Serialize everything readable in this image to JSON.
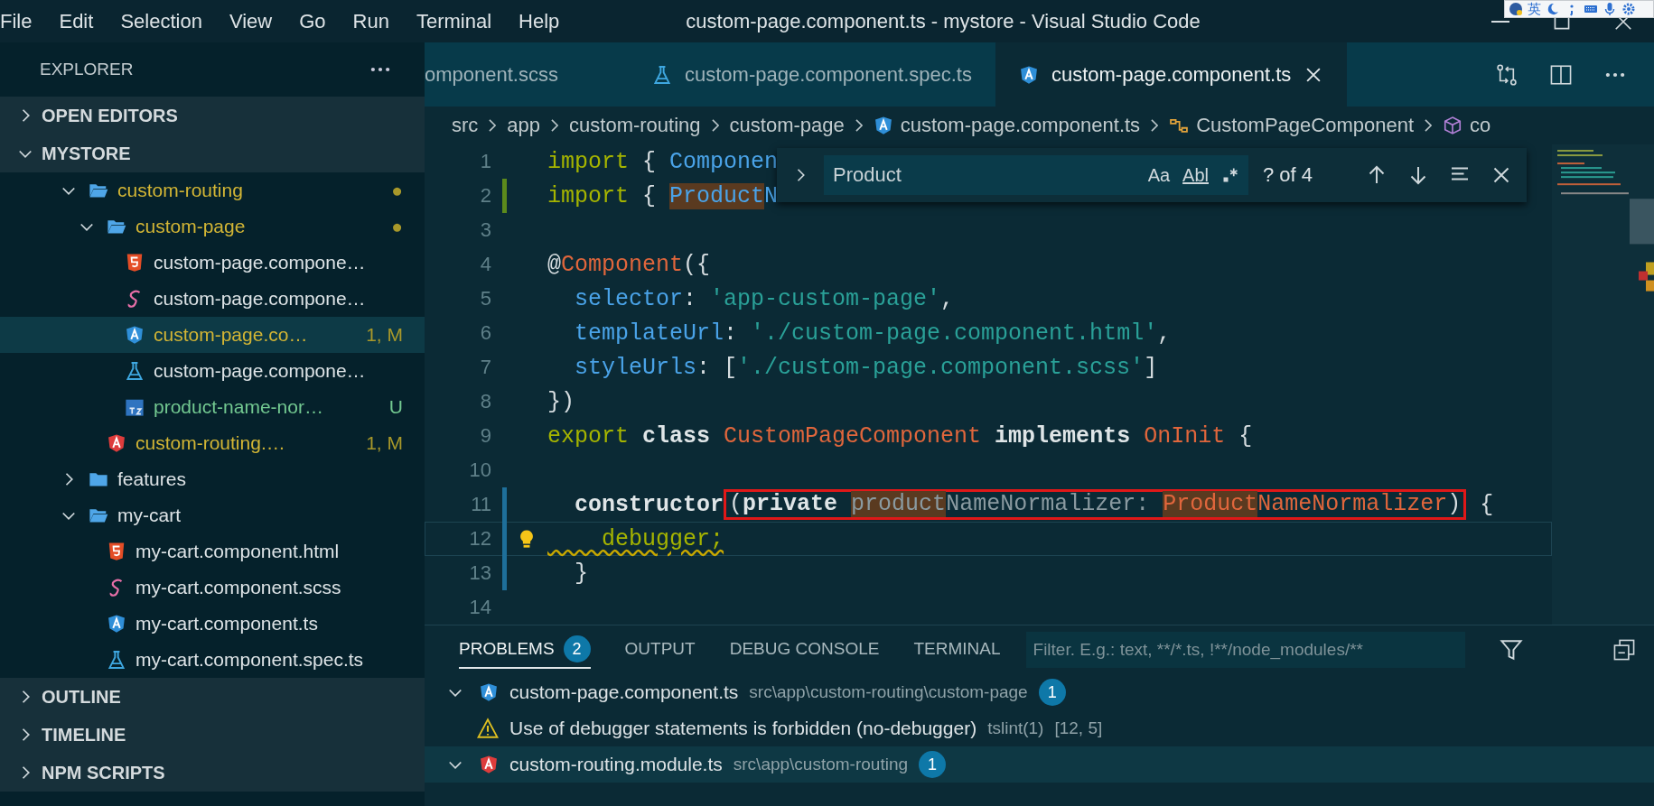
{
  "menu": [
    "File",
    "Edit",
    "Selection",
    "View",
    "Go",
    "Run",
    "Terminal",
    "Help"
  ],
  "window": {
    "title": "custom-page.component.ts - mystore - Visual Studio Code"
  },
  "ime_toolbar": {
    "label": "英"
  },
  "sidebar": {
    "title": "EXPLORER",
    "sections": [
      {
        "label": "OPEN EDITORS",
        "expanded": false
      },
      {
        "label": "MYSTORE",
        "expanded": true
      }
    ],
    "tree": [
      {
        "name": "custom-routing",
        "kind": "folder",
        "modified": true,
        "untracked": false,
        "expanded": true,
        "selected": false,
        "badge": "●",
        "children": [
          {
            "name": "custom-page",
            "kind": "folder",
            "modified": true,
            "untracked": false,
            "expanded": true,
            "selected": false,
            "badge": "●",
            "children": [
              {
                "name": "custom-page.compone…",
                "kind": "html",
                "modified": false,
                "untracked": false,
                "selected": false
              },
              {
                "name": "custom-page.compone…",
                "kind": "scss",
                "modified": false,
                "untracked": false,
                "selected": false
              },
              {
                "name": "custom-page.co…",
                "kind": "angular",
                "modified": true,
                "untracked": false,
                "selected": true,
                "badge": "1, M"
              },
              {
                "name": "custom-page.compone…",
                "kind": "spec",
                "modified": false,
                "untracked": false,
                "selected": false
              },
              {
                "name": "product-name-nor…",
                "kind": "ts",
                "modified": false,
                "untracked": true,
                "selected": false,
                "badge": "U"
              }
            ]
          },
          {
            "name": "custom-routing.…",
            "kind": "module",
            "modified": true,
            "untracked": false,
            "selected": false,
            "badge": "1, M"
          }
        ]
      },
      {
        "name": "features",
        "kind": "folder",
        "modified": false,
        "untracked": false,
        "expanded": false,
        "selected": false
      },
      {
        "name": "my-cart",
        "kind": "folder",
        "modified": false,
        "untracked": false,
        "expanded": true,
        "selected": false,
        "children": [
          {
            "name": "my-cart.component.html",
            "kind": "html",
            "modified": false,
            "untracked": false,
            "selected": false
          },
          {
            "name": "my-cart.component.scss",
            "kind": "scss",
            "modified": false,
            "untracked": false,
            "selected": false
          },
          {
            "name": "my-cart.component.ts",
            "kind": "angular",
            "modified": false,
            "untracked": false,
            "selected": false
          },
          {
            "name": "my-cart.component.spec.ts",
            "kind": "spec",
            "modified": false,
            "untracked": false,
            "selected": false
          }
        ]
      }
    ],
    "bottom_sections": [
      {
        "label": "OUTLINE",
        "expanded": false
      },
      {
        "label": "TIMELINE",
        "expanded": false
      },
      {
        "label": "NPM SCRIPTS",
        "expanded": false
      }
    ]
  },
  "tabs": [
    {
      "label": "omponent.scss",
      "kind": "none",
      "selected": false
    },
    {
      "label": "custom-page.component.spec.ts",
      "kind": "spec",
      "selected": false
    },
    {
      "label": "custom-page.component.ts",
      "kind": "angular",
      "selected": true
    }
  ],
  "breadcrumbs": [
    {
      "label": "src",
      "kind": "none"
    },
    {
      "label": "app",
      "kind": "none"
    },
    {
      "label": "custom-routing",
      "kind": "none"
    },
    {
      "label": "custom-page",
      "kind": "none"
    },
    {
      "label": "custom-page.component.ts",
      "kind": "angular"
    },
    {
      "label": "CustomPageComponent",
      "kind": "class"
    },
    {
      "label": "co",
      "kind": "method"
    }
  ],
  "find": {
    "value": "Product",
    "options": [
      "Aa",
      "Abl"
    ],
    "result": "? of 4"
  },
  "editor": {
    "lines": [
      {
        "number": "1",
        "added": false,
        "modified": false,
        "tokens": [
          {
            "kind": "kw",
            "text": "import"
          },
          {
            "kind": "plain",
            "text": " { "
          },
          {
            "kind": "type",
            "text": "Componen"
          }
        ]
      },
      {
        "number": "2",
        "added": true,
        "modified": false,
        "tokens": [
          {
            "kind": "kw",
            "text": "import"
          },
          {
            "kind": "plain",
            "text": " { "
          },
          {
            "kind": "type",
            "text": "Product",
            "match": true
          },
          {
            "kind": "type",
            "text": "N"
          }
        ]
      },
      {
        "number": "3",
        "added": false,
        "modified": false
      },
      {
        "number": "4",
        "added": false,
        "modified": false,
        "tokens": [
          {
            "kind": "plain",
            "text": "@"
          },
          {
            "kind": "cls",
            "text": "Component"
          },
          {
            "kind": "plain",
            "text": "({"
          }
        ]
      },
      {
        "number": "5",
        "added": false,
        "modified": false,
        "tokens": [
          {
            "kind": "prop",
            "text": "  selector"
          },
          {
            "kind": "plain",
            "text": ": "
          },
          {
            "kind": "str",
            "text": "'app-custom-page'"
          },
          {
            "kind": "plain",
            "text": ","
          }
        ]
      },
      {
        "number": "6",
        "added": false,
        "modified": false,
        "tokens": [
          {
            "kind": "prop",
            "text": "  templateUrl"
          },
          {
            "kind": "plain",
            "text": ": "
          },
          {
            "kind": "str",
            "text": "'./custom-page.component.html'"
          },
          {
            "kind": "plain",
            "text": ","
          }
        ]
      },
      {
        "number": "7",
        "added": false,
        "modified": false,
        "tokens": [
          {
            "kind": "prop",
            "text": "  styleUrls"
          },
          {
            "kind": "plain",
            "text": ": ["
          },
          {
            "kind": "str",
            "text": "'./custom-page.component.scss'"
          },
          {
            "kind": "plain",
            "text": "]"
          }
        ]
      },
      {
        "number": "8",
        "added": false,
        "modified": false,
        "tokens": [
          {
            "kind": "plain",
            "text": "})"
          }
        ]
      },
      {
        "number": "9",
        "added": false,
        "modified": false,
        "tokens": [
          {
            "kind": "kw",
            "text": "export "
          },
          {
            "kind": "bold",
            "text": "class "
          },
          {
            "kind": "cls",
            "text": "CustomPageComponent "
          },
          {
            "kind": "bold",
            "text": "implements "
          },
          {
            "kind": "cls",
            "text": "OnInit"
          },
          {
            "kind": "plain",
            "text": " {"
          }
        ]
      },
      {
        "number": "10",
        "added": false,
        "modified": false
      },
      {
        "number": "11",
        "added": false,
        "modified": true,
        "tokens": [
          {
            "kind": "bold",
            "text": "  constructor"
          },
          {
            "kind": "group",
            "boxed": true,
            "tokens": [
              {
                "kind": "plain",
                "text": "("
              },
              {
                "kind": "bold",
                "text": "private "
              },
              {
                "kind": "dim",
                "text": "product",
                "match": true
              },
              {
                "kind": "dim",
                "text": "NameNormalizer: "
              },
              {
                "kind": "cls",
                "text": "Product",
                "match": true
              },
              {
                "kind": "cls",
                "text": "NameNormalizer"
              },
              {
                "kind": "plain",
                "text": ")"
              }
            ]
          },
          {
            "kind": "plain",
            "text": " {"
          }
        ]
      },
      {
        "number": "12",
        "added": false,
        "modified": true,
        "current": true,
        "lightbulb": true,
        "tokens": [
          {
            "kind": "warn",
            "text": "    debugger;"
          }
        ]
      },
      {
        "number": "13",
        "added": false,
        "modified": true,
        "tokens": [
          {
            "kind": "plain",
            "text": "  }"
          }
        ]
      },
      {
        "number": "14",
        "added": false,
        "modified": false
      }
    ]
  },
  "panel": {
    "tabs": [
      {
        "label": "PROBLEMS",
        "badge": "2",
        "selected": true
      },
      {
        "label": "OUTPUT",
        "selected": false
      },
      {
        "label": "DEBUG CONSOLE",
        "selected": false
      },
      {
        "label": "TERMINAL",
        "selected": false
      }
    ],
    "filter": {
      "placeholder": "Filter. E.g.: text, **/*.ts, !**/node_modules/**"
    },
    "rows": [
      {
        "kind": "component",
        "name": "custom-page.component.ts",
        "path": "src\\app\\custom-routing\\custom-page",
        "count": "1",
        "expanded": true,
        "selected": false
      },
      {
        "kind": "problem",
        "message": "Use of debugger statements is forbidden (no-debugger)",
        "source": "tslint(1)",
        "location": "[12, 5]",
        "selected": false
      },
      {
        "kind": "module",
        "name": "custom-routing.module.ts",
        "path": "src\\app\\custom-routing",
        "count": "1",
        "expanded": true,
        "selected": true
      }
    ]
  }
}
